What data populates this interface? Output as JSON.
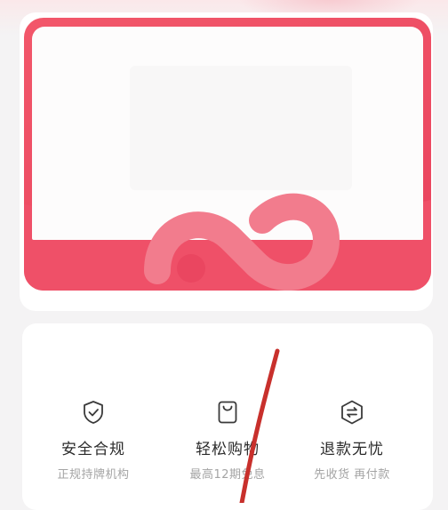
{
  "benefits": [
    {
      "icon": "shield-check-icon",
      "title": "安全合规",
      "subtitle": "正规持牌机构"
    },
    {
      "icon": "shopping-bag-icon",
      "title": "轻松购物",
      "subtitle": "最高12期免息"
    },
    {
      "icon": "exchange-shield-icon",
      "title": "退款无忧",
      "subtitle": "先收货 再付款"
    }
  ],
  "colors": {
    "brand_red": "#ec4a62",
    "icon_stroke": "#3a3a3a",
    "title_text": "#2b2b2b",
    "subtitle_text": "#a4a4a4",
    "annotation_stroke": "#c8302c"
  }
}
